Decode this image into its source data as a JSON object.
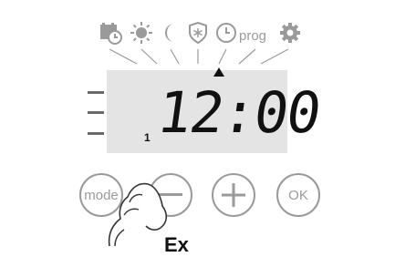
{
  "mode_icons": [
    {
      "name": "calendar-clock-icon"
    },
    {
      "name": "sun-icon"
    },
    {
      "name": "moon-icon"
    },
    {
      "name": "frost-shield-icon"
    },
    {
      "name": "clock-icon"
    },
    {
      "name": "prog-label",
      "text": "prog"
    },
    {
      "name": "gear-icon"
    }
  ],
  "display": {
    "time": "12:00",
    "day_number": "1",
    "selected_mode": "clock"
  },
  "buttons": {
    "mode_label": "mode",
    "minus_label": "—",
    "plus_label": "+",
    "ok_label": "OK"
  },
  "partial_caption": "Ex"
}
